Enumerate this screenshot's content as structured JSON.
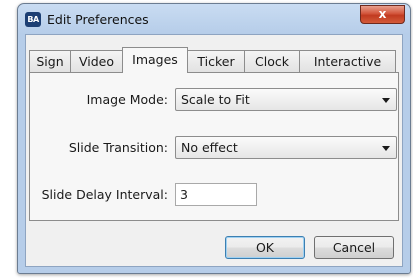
{
  "window": {
    "title": "Edit Preferences",
    "icon_text": "BA",
    "icon_name": "app-logo-icon",
    "close_glyph": "x"
  },
  "tabs": [
    {
      "label": "Sign",
      "selected": false
    },
    {
      "label": "Video",
      "selected": false
    },
    {
      "label": "Images",
      "selected": true
    },
    {
      "label": "Ticker",
      "selected": false
    },
    {
      "label": "Clock",
      "selected": false
    },
    {
      "label": "Interactive",
      "selected": false
    }
  ],
  "images_tab": {
    "image_mode": {
      "label": "Image Mode:",
      "value": "Scale to Fit"
    },
    "slide_transition": {
      "label": "Slide Transition:",
      "value": "No effect"
    },
    "slide_delay": {
      "label": "Slide Delay Interval:",
      "value": "3"
    }
  },
  "buttons": {
    "ok": "OK",
    "cancel": "Cancel"
  },
  "colors": {
    "frame": "#b6cde9",
    "close_button": "#c13a20",
    "dialog_background": "#f0f0f0",
    "default_button_border": "#3c7fb1"
  }
}
